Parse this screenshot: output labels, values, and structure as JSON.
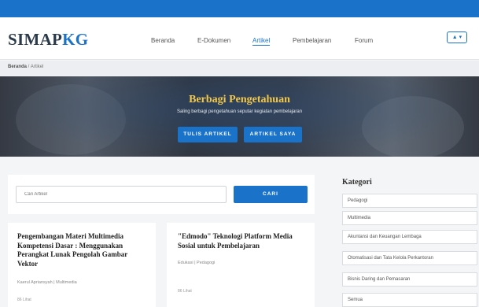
{
  "app": {
    "logo_part1": "SIMAP",
    "logo_part2": "KG"
  },
  "nav": {
    "items": [
      {
        "label": "Beranda",
        "active": false
      },
      {
        "label": "E-Dokumen",
        "active": false
      },
      {
        "label": "Artikel",
        "active": true
      },
      {
        "label": "Pembelajaran",
        "active": false
      },
      {
        "label": "Forum",
        "active": false
      }
    ],
    "user_button": "▲ ▾"
  },
  "breadcrumb": {
    "home": "Beranda",
    "separator": " / ",
    "current": "Artikel"
  },
  "hero": {
    "title": "Berbagi Pengetahuan",
    "subtitle": "Saling berbagi pengetahuan seputar kegiatan pembelajaran",
    "write_button": "TULIS ARTIKEL",
    "my_button": "ARTIKEL SAYA"
  },
  "search": {
    "placeholder": "Cari Artikel",
    "button": "CARI"
  },
  "articles": [
    {
      "title": "Pengembangan Materi Multimedia Kompetensi Dasar : Menggunakan Perangkat Lunak Pengolah Gambar Vektor",
      "meta": "Kaerul Apriansyah | Multimedia",
      "views": "86 Lihat"
    },
    {
      "title": "\"Edmodo\" Teknologi Platform Media Sosial untuk Pembelajaran",
      "meta": "Edukasi | Pedagogi",
      "views": "86 Lihat"
    }
  ],
  "categories": {
    "heading": "Kategori",
    "items": [
      "Pedagogi",
      "Multimedia",
      "Akuntansi dan Keuangan Lembaga",
      "Otomatisasi dan Tata Kelola Perkantoran",
      "Bisnis Daring dan Pemasaran",
      "Semua"
    ]
  },
  "colors": {
    "primary": "#1a73c8",
    "hero_title": "#f2c94c",
    "topbar": "#1a73c8"
  }
}
